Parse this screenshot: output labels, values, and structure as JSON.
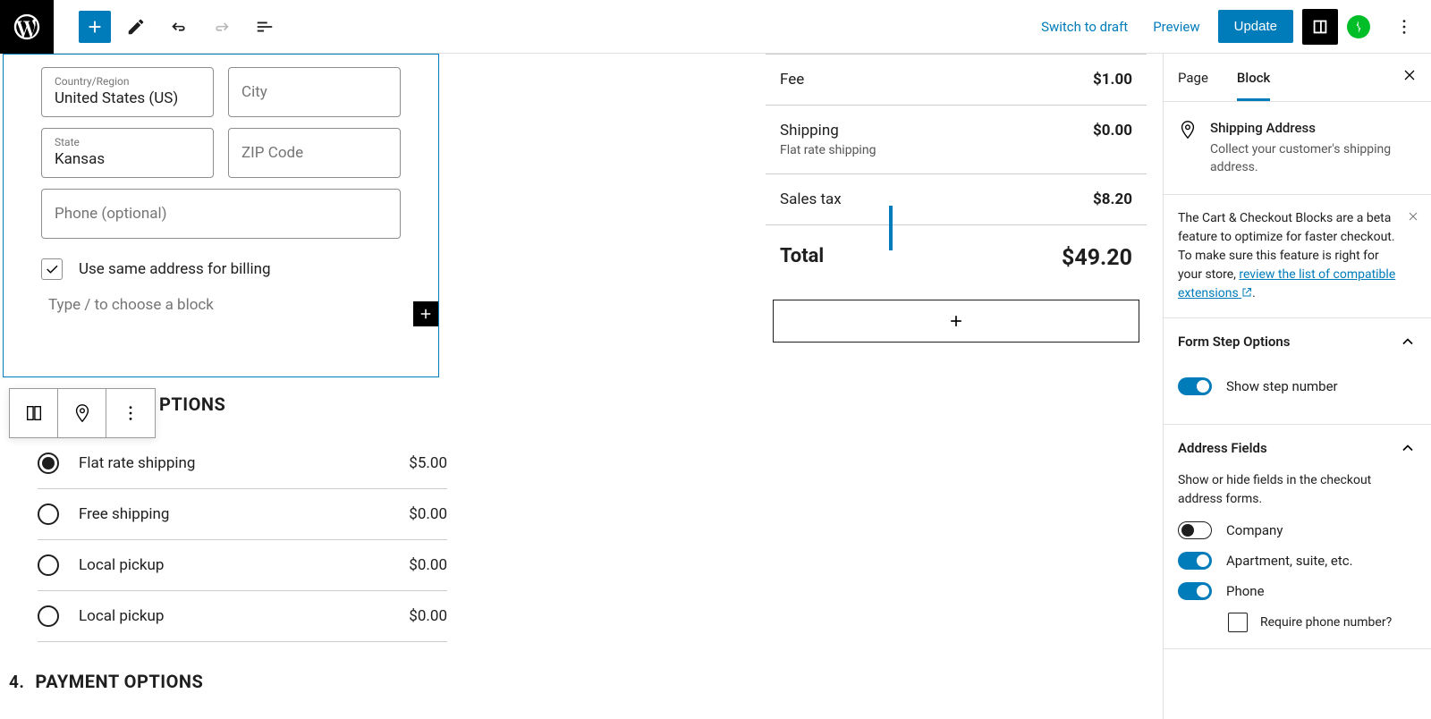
{
  "topbar": {
    "switch_draft": "Switch to draft",
    "preview": "Preview",
    "update": "Update"
  },
  "form": {
    "country_label": "Country/Region",
    "country_value": "United States (US)",
    "city_placeholder": "City",
    "state_label": "State",
    "state_value": "Kansas",
    "zip_placeholder": "ZIP Code",
    "phone_placeholder": "Phone (optional)",
    "same_billing": "Use same address for billing",
    "block_placeholder": "Type / to choose a block"
  },
  "shipping_heading_partial": "PTIONS",
  "shipping_options": [
    {
      "name": "Flat rate shipping",
      "price": "$5.00",
      "selected": true
    },
    {
      "name": "Free shipping",
      "price": "$0.00",
      "selected": false
    },
    {
      "name": "Local pickup",
      "price": "$0.00",
      "selected": false
    },
    {
      "name": "Local pickup",
      "price": "$0.00",
      "selected": false
    }
  ],
  "payment": {
    "num": "4.",
    "title": "PAYMENT OPTIONS"
  },
  "totals": {
    "fee_label": "Fee",
    "fee_value": "$1.00",
    "shipping_label": "Shipping",
    "shipping_sub": "Flat rate shipping",
    "shipping_value": "$0.00",
    "tax_label": "Sales tax",
    "tax_value": "$8.20",
    "total_label": "Total",
    "total_value": "$49.20"
  },
  "sidebar": {
    "tab_page": "Page",
    "tab_block": "Block",
    "block_title": "Shipping Address",
    "block_desc": "Collect your customer's shipping address.",
    "notice_pre": "The Cart & Checkout Blocks are a beta feature to optimize for faster checkout. To make sure this feature is right for your store, ",
    "notice_link": "review the list of compatible extensions",
    "panel1_title": "Form Step Options",
    "panel1_toggle": "Show step number",
    "panel2_title": "Address Fields",
    "panel2_hint": "Show or hide fields in the checkout address forms.",
    "field_company": "Company",
    "field_apt": "Apartment, suite, etc.",
    "field_phone": "Phone",
    "require_phone": "Require phone number?"
  }
}
